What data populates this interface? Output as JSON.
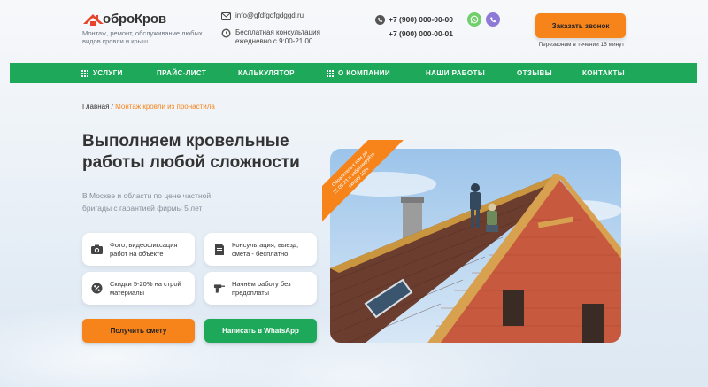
{
  "logo": {
    "text": "оброКров",
    "subtitle": "Монтаж, ремонт, обслуживание любых видов кровли и крыш"
  },
  "contacts": {
    "email": "info@gfdfgdfgdggd.ru",
    "consult": "Бесплатная консультация",
    "hours": "ежедневно с 9:00-21:00",
    "phone1": "+7 (900) 000-00-00",
    "phone2": "+7 (900) 000-00-01"
  },
  "call": {
    "button": "Заказать звонок",
    "note": "Перезвоним в течении 15 минут"
  },
  "nav": [
    {
      "label": "УСЛУГИ",
      "icon": "grid-icon"
    },
    {
      "label": "ПРАЙС-ЛИСТ"
    },
    {
      "label": "КАЛЬКУЛЯТОР"
    },
    {
      "label": "О КОМПАНИИ",
      "icon": "grid-icon"
    },
    {
      "label": "НАШИ РАБОТЫ"
    },
    {
      "label": "ОТЗЫВЫ"
    },
    {
      "label": "КОНТАКТЫ"
    }
  ],
  "breadcrumb": {
    "home": "Главная",
    "sep": " / ",
    "current": "Монтаж кровли из пронастила"
  },
  "hero": {
    "title": "Выполняем кровельные работы любой сложности",
    "subtitle": "В Москве и области по цене частной бригады с гарантией фирмы 5 лет"
  },
  "features": [
    {
      "text": "Фото, видеофиксация работ на объекте",
      "icon": "camera-icon"
    },
    {
      "text": "Консультация, выезд, смета - бесплатно",
      "icon": "document-icon"
    },
    {
      "text": "Скидки 5-20% на строй материалы",
      "icon": "discount-icon"
    },
    {
      "text": "Начнём работу без предоплаты",
      "icon": "drill-icon"
    }
  ],
  "buttons": {
    "estimate": "Получить смету",
    "whatsapp": "Написать в WhatsApp"
  },
  "ribbon": {
    "line1": "Обратитесь к нам до",
    "line2": "25.05.23 и забронируйте",
    "line3": "скидку 10%"
  },
  "colors": {
    "accent": "#f7831b",
    "brand_green": "#1ea95a",
    "text": "#333333"
  }
}
